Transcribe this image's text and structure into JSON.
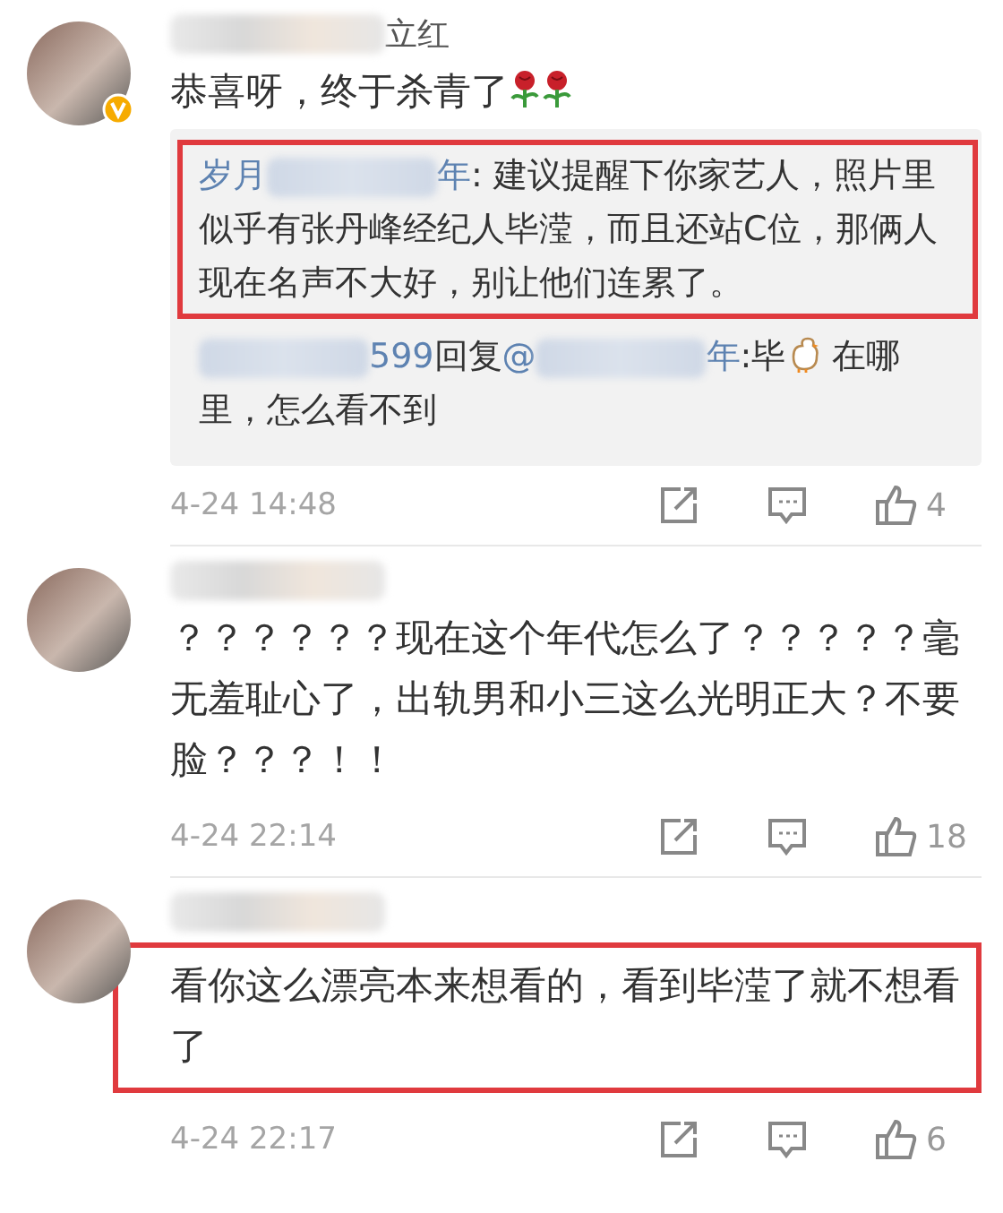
{
  "comments": [
    {
      "author": [
        {
          "kind": "blur"
        },
        {
          "kind": "text",
          "text": "立红"
        }
      ],
      "verified": true,
      "text": "恭喜呀，终于杀青了",
      "emoji": [
        {
          "kind": "rose"
        },
        {
          "kind": "rose"
        }
      ],
      "highlighted": false,
      "replies": [
        {
          "highlighted": true,
          "segments": [
            {
              "kind": "link",
              "text": "岁月"
            },
            {
              "kind": "blur"
            },
            {
              "kind": "link",
              "text": "年"
            },
            {
              "kind": "text",
              "text": ": 建议提醒下你家艺人，照片里似乎有张丹峰经纪人毕滢，而且还站C位，那俩人现在名声不大好，别让他们连累了。"
            }
          ]
        },
        {
          "highlighted": false,
          "segments": [
            {
              "kind": "blur"
            },
            {
              "kind": "link",
              "text": "599"
            },
            {
              "kind": "text",
              "text": "回复"
            },
            {
              "kind": "link",
              "text": "@"
            },
            {
              "kind": "blur"
            },
            {
              "kind": "link",
              "text": "年"
            },
            {
              "kind": "text",
              "text": ":毕"
            },
            {
              "kind": "chick"
            },
            {
              "kind": "text",
              "text": " 在哪里，怎么看不到"
            }
          ]
        }
      ],
      "time": "4-24 14:48",
      "likes": "4"
    },
    {
      "author": [
        {
          "kind": "blur"
        }
      ],
      "text": "？？？？？？现在这个年代怎么了？？？？？毫无羞耻心了，出轨男和小三这么光明正大？不要脸？？？！！",
      "highlighted": false,
      "time": "4-24 22:14",
      "likes": "18"
    },
    {
      "author": [
        {
          "kind": "blur"
        }
      ],
      "text": "看你这么漂亮本来想看的，看到毕滢了就不想看了",
      "highlighted": true,
      "time": "4-24 22:17",
      "likes": "6"
    }
  ]
}
